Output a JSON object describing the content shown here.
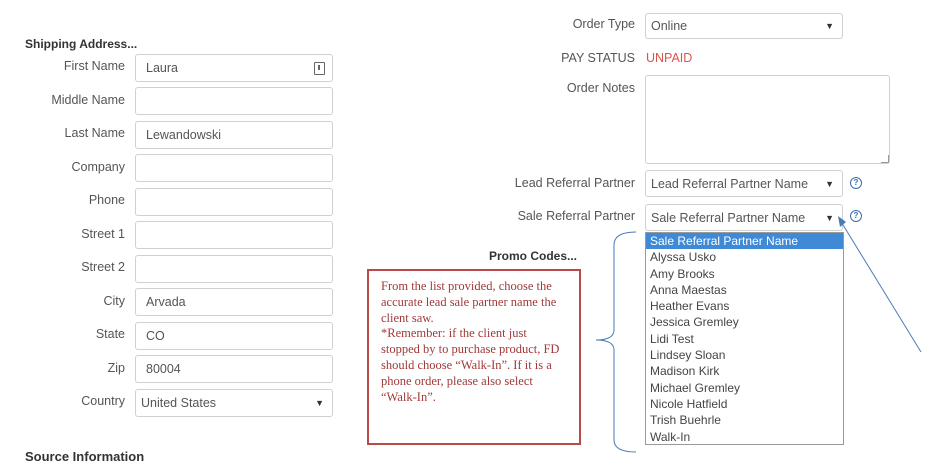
{
  "shipping": {
    "title": "Shipping Address...",
    "first_name": {
      "label": "First Name",
      "value": "Laura"
    },
    "middle_name": {
      "label": "Middle Name",
      "value": ""
    },
    "last_name": {
      "label": "Last Name",
      "value": "Lewandowski"
    },
    "company": {
      "label": "Company",
      "value": ""
    },
    "phone": {
      "label": "Phone",
      "value": ""
    },
    "street1": {
      "label": "Street 1",
      "value": ""
    },
    "street2": {
      "label": "Street 2",
      "value": ""
    },
    "city": {
      "label": "City",
      "value": "Arvada"
    },
    "state": {
      "label": "State",
      "value": "CO"
    },
    "zip": {
      "label": "Zip",
      "value": "80004"
    },
    "country": {
      "label": "Country",
      "value": "United States"
    }
  },
  "source_title": "Source Information",
  "order": {
    "type_label": "Order Type",
    "type_value": "Online",
    "pay_status_label": "PAY STATUS",
    "pay_status_value": "UNPAID",
    "notes_label": "Order Notes",
    "notes_value": "",
    "lead_referral_label": "Lead Referral Partner",
    "lead_referral_value": "Lead Referral Partner Name",
    "sale_referral_label": "Sale Referral Partner",
    "sale_referral_value": "Sale Referral Partner Name",
    "promo_label": "Promo Codes..."
  },
  "dropdown_options": [
    "Sale Referral Partner Name",
    "Alyssa Usko",
    "Amy Brooks",
    "Anna Maestas",
    "Heather Evans",
    "Jessica Gremley",
    "Lidi Test",
    "Lindsey Sloan",
    "Madison Kirk",
    "Michael Gremley",
    "Nicole Hatfield",
    "Trish Buehrle",
    "Walk-In"
  ],
  "annotation": {
    "line1": "From the list provided, choose the accurate lead sale partner name the client saw.",
    "line2": "*Remember: if the client just stopped by to purchase product, FD should choose “Walk-In”. If it is a phone order, please also select “Walk-In”."
  },
  "colors": {
    "unpaid": "#d9534f",
    "selected_option": "#3e8ad6",
    "note_border": "#b94a48",
    "help_icon": "#3a6fb0"
  },
  "icons": {
    "help": "question-circle-icon",
    "caret": "caret-down-icon",
    "contact_card": "contact-card-icon"
  }
}
